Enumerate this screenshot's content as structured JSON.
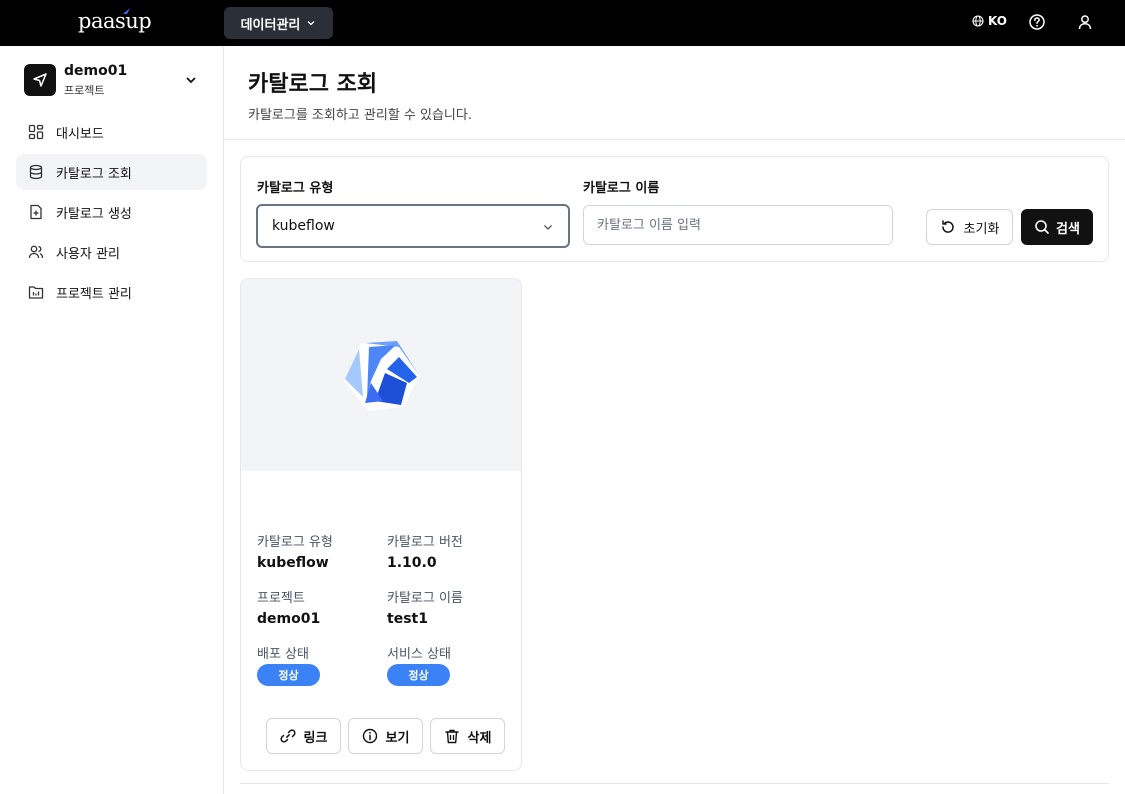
{
  "topbar": {
    "logo_text": "paasup",
    "menu_label": "데이터관리",
    "language": "KO",
    "icons": [
      "globe-icon",
      "help-icon",
      "user-icon"
    ]
  },
  "sidebar": {
    "project_name": "demo01",
    "project_subtitle": "프로젝트",
    "items": [
      {
        "label": "대시보드",
        "icon": "dashboard-icon",
        "active": false
      },
      {
        "label": "카탈로그 조회",
        "icon": "database-icon",
        "active": true
      },
      {
        "label": "카탈로그 생성",
        "icon": "file-plus-icon",
        "active": false
      },
      {
        "label": "사용자 관리",
        "icon": "users-icon",
        "active": false
      },
      {
        "label": "프로젝트 관리",
        "icon": "folder-chart-icon",
        "active": false
      }
    ]
  },
  "page": {
    "title": "카탈로그 조회",
    "description": "카탈로그를 조회하고 관리할 수 있습니다."
  },
  "filter": {
    "type_label": "카탈로그 유형",
    "type_value": "kubeflow",
    "name_label": "카탈로그 이름",
    "name_placeholder": "카탈로그 이름 입력",
    "name_value": "",
    "reset_label": "초기화",
    "search_label": "검색"
  },
  "cards": [
    {
      "type_label": "카탈로그 유형",
      "type_value": "kubeflow",
      "version_label": "카탈로그 버전",
      "version_value": "1.10.0",
      "project_label": "프로젝트",
      "project_value": "demo01",
      "name_label": "카탈로그 이름",
      "name_value": "test1",
      "deploy_label": "배포 상태",
      "deploy_status": "정상",
      "service_label": "서비스 상태",
      "service_status": "정상",
      "link_label": "링크",
      "view_label": "보기",
      "delete_label": "삭제"
    }
  ],
  "colors": {
    "topbar_bg": "#000000",
    "accent_blue": "#3b82f6",
    "primary_button": "#111111",
    "logo_accent": "#3b6cff"
  }
}
